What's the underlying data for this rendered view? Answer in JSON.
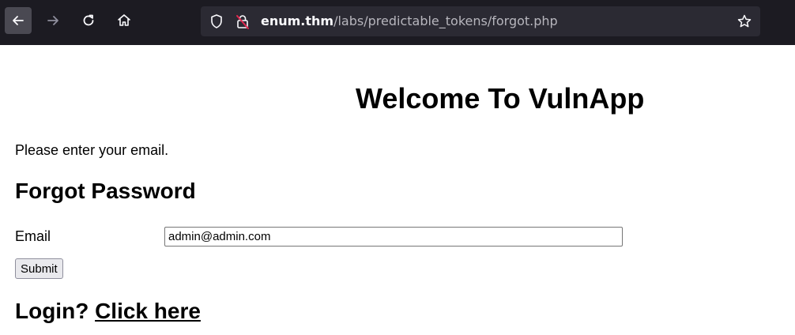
{
  "browser": {
    "url_host": "enum.thm",
    "url_path": "/labs/predictable_tokens/forgot.php",
    "icons": [
      "back-arrow-icon",
      "forward-arrow-icon",
      "reload-icon",
      "home-icon",
      "shield-icon",
      "insecure-lock-icon",
      "bookmark-star-icon"
    ]
  },
  "page": {
    "title": "Welcome To VulnApp",
    "instruction": "Please enter your email.",
    "heading": "Forgot Password",
    "email_label": "Email",
    "email_value": "admin@admin.com",
    "submit_label": "Submit",
    "login_prompt": "Login?",
    "login_link": "Click here"
  }
}
